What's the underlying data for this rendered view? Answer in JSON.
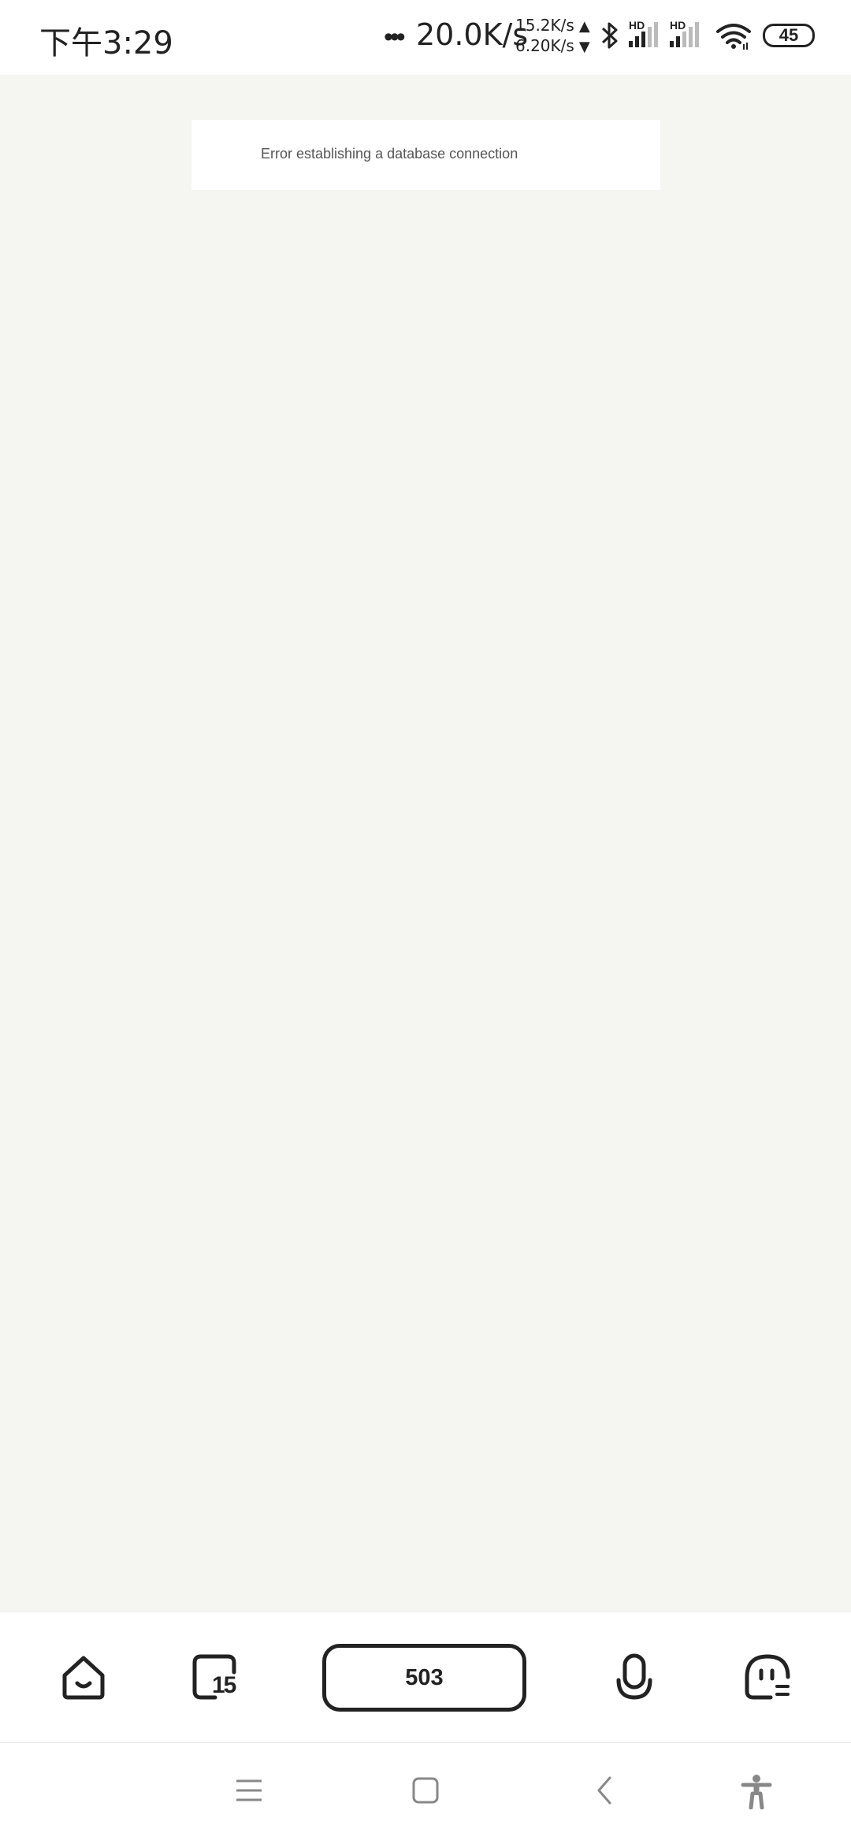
{
  "status_bar": {
    "time": "下午3:29",
    "dots": "•••",
    "speed": "20.0K/s",
    "upload_rate": "15.2K/s",
    "upload_arrow": "▲",
    "download_rate": "6.20K/s",
    "download_arrow": "▼",
    "hd_label_1": "HD",
    "hd_label_2": "HD",
    "battery": "45",
    "icons": [
      "bluetooth-icon",
      "signal-icon",
      "signal-icon",
      "wifi-icon",
      "battery-icon"
    ]
  },
  "page": {
    "error_message": "Error establishing a database connection"
  },
  "toolbar": {
    "home_icon": "home-icon",
    "tabs_icon": "tabs-icon",
    "tab_count": "15",
    "center_label": "503",
    "mic_icon": "microphone-icon",
    "profile_icon": "profile-menu-icon"
  },
  "navbar": {
    "icons": [
      "menu-icon",
      "home-square-icon",
      "back-icon",
      "accessibility-icon"
    ]
  },
  "colors": {
    "page_background": "#f5f5f1",
    "surface": "#ffffff",
    "icon": "#222222",
    "muted_text": "#555555"
  }
}
